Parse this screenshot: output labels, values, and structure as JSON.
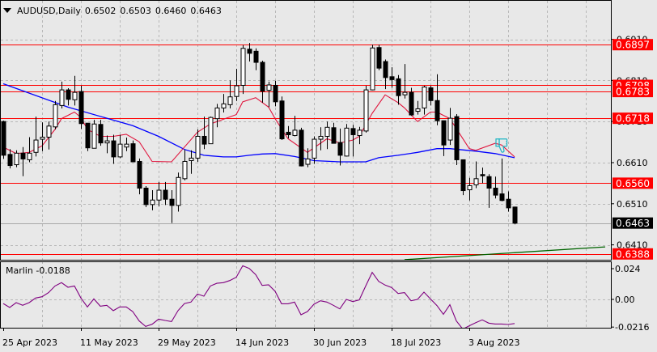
{
  "header": {
    "symbol_timeframe": "AUDUSD,Daily",
    "open": "0.6502",
    "high": "0.6503",
    "low": "0.6460",
    "close": "0.6463",
    "menu_icon": "triangle-down-icon"
  },
  "colors": {
    "background": "#e8e8e8",
    "level_line": "#ff0000",
    "ma_fast": "#e0143c",
    "ma_slow": "#0000ff",
    "trendline": "#006400",
    "indicator": "#800080",
    "signal_icon": "#1fb5c4",
    "bull_body": "#ffffff",
    "bear_body": "#000000"
  },
  "chart_data": [
    {
      "type": "candlestick",
      "y_ticks": [
        "0.6910",
        "0.6810",
        "0.6710",
        "0.6610",
        "0.6510",
        "0.6410"
      ],
      "ylim": [
        0.637,
        0.6935
      ],
      "grid": true,
      "x_tick_labels": [
        {
          "bar": 0,
          "label": "25 Apr 2023"
        },
        {
          "bar": 12,
          "label": "11 May 2023"
        },
        {
          "bar": 24,
          "label": "29 May 2023"
        },
        {
          "bar": 36,
          "label": "14 Jun 2023"
        },
        {
          "bar": 48,
          "label": "30 Jun 2023"
        },
        {
          "bar": 60,
          "label": "18 Jul 2023"
        },
        {
          "bar": 72,
          "label": "3 Aug 2023"
        }
      ],
      "candles_ohlc": [
        [
          0.671,
          0.6712,
          0.6619,
          0.6628
        ],
        [
          0.663,
          0.6643,
          0.6596,
          0.6603
        ],
        [
          0.6605,
          0.664,
          0.6599,
          0.6633
        ],
        [
          0.6633,
          0.6648,
          0.6577,
          0.6619
        ],
        [
          0.6617,
          0.6672,
          0.6611,
          0.6633
        ],
        [
          0.6635,
          0.6722,
          0.6625,
          0.6665
        ],
        [
          0.6667,
          0.6708,
          0.6638,
          0.6672
        ],
        [
          0.6672,
          0.671,
          0.6642,
          0.6699
        ],
        [
          0.6697,
          0.676,
          0.6691,
          0.6751
        ],
        [
          0.6749,
          0.6807,
          0.6742,
          0.6787
        ],
        [
          0.6787,
          0.6791,
          0.6749,
          0.6764
        ],
        [
          0.6763,
          0.6821,
          0.6749,
          0.6781
        ],
        [
          0.6783,
          0.6797,
          0.6692,
          0.6705
        ],
        [
          0.6706,
          0.6706,
          0.6638,
          0.6646
        ],
        [
          0.6645,
          0.6714,
          0.6645,
          0.6704
        ],
        [
          0.6703,
          0.6714,
          0.6651,
          0.6658
        ],
        [
          0.6658,
          0.6676,
          0.6633,
          0.6663
        ],
        [
          0.6663,
          0.6678,
          0.6607,
          0.6624
        ],
        [
          0.6624,
          0.6678,
          0.6621,
          0.6655
        ],
        [
          0.6648,
          0.6671,
          0.6638,
          0.6655
        ],
        [
          0.6656,
          0.6664,
          0.6612,
          0.6612
        ],
        [
          0.6613,
          0.662,
          0.6533,
          0.6548
        ],
        [
          0.6548,
          0.6553,
          0.6502,
          0.6508
        ],
        [
          0.6508,
          0.6543,
          0.6494,
          0.6519
        ],
        [
          0.6519,
          0.6563,
          0.6504,
          0.6543
        ],
        [
          0.6543,
          0.6563,
          0.6507,
          0.6521
        ],
        [
          0.6521,
          0.6543,
          0.6463,
          0.6506
        ],
        [
          0.6506,
          0.6586,
          0.6491,
          0.6574
        ],
        [
          0.6571,
          0.6641,
          0.6567,
          0.6613
        ],
        [
          0.6615,
          0.664,
          0.6583,
          0.6621
        ],
        [
          0.6621,
          0.6691,
          0.6612,
          0.6674
        ],
        [
          0.6674,
          0.6722,
          0.6643,
          0.6655
        ],
        [
          0.6656,
          0.6722,
          0.6656,
          0.672
        ],
        [
          0.6717,
          0.6753,
          0.6696,
          0.6743
        ],
        [
          0.6743,
          0.6777,
          0.6732,
          0.6753
        ],
        [
          0.6751,
          0.681,
          0.6742,
          0.677
        ],
        [
          0.6771,
          0.6838,
          0.676,
          0.6797
        ],
        [
          0.6798,
          0.6896,
          0.6777,
          0.6888
        ],
        [
          0.6886,
          0.6901,
          0.6856,
          0.6876
        ],
        [
          0.6881,
          0.6888,
          0.6835,
          0.6854
        ],
        [
          0.6854,
          0.6858,
          0.6756,
          0.6784
        ],
        [
          0.6786,
          0.6807,
          0.6745,
          0.6799
        ],
        [
          0.6798,
          0.6809,
          0.6747,
          0.6758
        ],
        [
          0.676,
          0.6771,
          0.6665,
          0.6668
        ],
        [
          0.6684,
          0.6699,
          0.6669,
          0.6678
        ],
        [
          0.6676,
          0.6724,
          0.6674,
          0.6689
        ],
        [
          0.6689,
          0.6695,
          0.6601,
          0.6602
        ],
        [
          0.6606,
          0.6645,
          0.6599,
          0.6619
        ],
        [
          0.6621,
          0.6674,
          0.6607,
          0.6667
        ],
        [
          0.6667,
          0.6696,
          0.664,
          0.6674
        ],
        [
          0.6674,
          0.671,
          0.6643,
          0.6696
        ],
        [
          0.6695,
          0.6707,
          0.6657,
          0.6657
        ],
        [
          0.6659,
          0.6693,
          0.6603,
          0.6628
        ],
        [
          0.6626,
          0.6704,
          0.6625,
          0.6694
        ],
        [
          0.6693,
          0.6702,
          0.6625,
          0.6678
        ],
        [
          0.6676,
          0.6697,
          0.6655,
          0.6689
        ],
        [
          0.6687,
          0.6797,
          0.6683,
          0.6787
        ],
        [
          0.6787,
          0.6897,
          0.6786,
          0.6889
        ],
        [
          0.689,
          0.6897,
          0.6835,
          0.684
        ],
        [
          0.6856,
          0.6861,
          0.6789,
          0.6817
        ],
        [
          0.6819,
          0.6842,
          0.6792,
          0.6812
        ],
        [
          0.6814,
          0.6823,
          0.6751,
          0.6773
        ],
        [
          0.6775,
          0.685,
          0.6766,
          0.6781
        ],
        [
          0.6781,
          0.6792,
          0.6724,
          0.6726
        ],
        [
          0.6735,
          0.676,
          0.6727,
          0.6741
        ],
        [
          0.6743,
          0.6797,
          0.6727,
          0.6794
        ],
        [
          0.6792,
          0.6797,
          0.6749,
          0.6761
        ],
        [
          0.6761,
          0.6825,
          0.6701,
          0.6712
        ],
        [
          0.6712,
          0.6712,
          0.6626,
          0.6653
        ],
        [
          0.6665,
          0.6743,
          0.6653,
          0.6718
        ],
        [
          0.6722,
          0.6728,
          0.6604,
          0.6617
        ],
        [
          0.6617,
          0.6617,
          0.6531,
          0.6542
        ],
        [
          0.6544,
          0.6573,
          0.6518,
          0.6554
        ],
        [
          0.6556,
          0.6613,
          0.6548,
          0.6571
        ],
        [
          0.6581,
          0.6598,
          0.656,
          0.6578
        ],
        [
          0.6576,
          0.6582,
          0.65,
          0.6548
        ],
        [
          0.6548,
          0.6576,
          0.6523,
          0.6531
        ],
        [
          0.6534,
          0.662,
          0.6516,
          0.6518
        ],
        [
          0.6521,
          0.654,
          0.6491,
          0.65
        ],
        [
          0.6502,
          0.6503,
          0.646,
          0.6463
        ]
      ],
      "ma_fast": [
        [
          0,
          0.6648
        ],
        [
          2,
          0.6632
        ],
        [
          4,
          0.6635
        ],
        [
          6,
          0.6651
        ],
        [
          8,
          0.6691
        ],
        [
          9,
          0.6717
        ],
        [
          11,
          0.6733
        ],
        [
          12,
          0.672
        ],
        [
          13,
          0.6691
        ],
        [
          15,
          0.6674
        ],
        [
          17,
          0.6674
        ],
        [
          19,
          0.6679
        ],
        [
          21,
          0.6661
        ],
        [
          23,
          0.6613
        ],
        [
          26,
          0.6612
        ],
        [
          28,
          0.6648
        ],
        [
          30,
          0.6684
        ],
        [
          32,
          0.6704
        ],
        [
          36,
          0.6727
        ],
        [
          37,
          0.6758
        ],
        [
          39,
          0.6768
        ],
        [
          41,
          0.6745
        ],
        [
          42,
          0.6717
        ],
        [
          44,
          0.6668
        ],
        [
          47,
          0.6635
        ],
        [
          50,
          0.6668
        ],
        [
          52,
          0.6658
        ],
        [
          54,
          0.6665
        ],
        [
          55,
          0.6674
        ],
        [
          57,
          0.673
        ],
        [
          59,
          0.6775
        ],
        [
          61,
          0.6756
        ],
        [
          62,
          0.6743
        ],
        [
          64,
          0.671
        ],
        [
          66,
          0.6733
        ],
        [
          67,
          0.6733
        ],
        [
          69,
          0.6717
        ],
        [
          72,
          0.6644
        ],
        [
          73,
          0.664
        ],
        [
          76,
          0.6657
        ],
        [
          77,
          0.6653
        ],
        [
          79,
          0.6624
        ]
      ],
      "ma_slow": [
        [
          0,
          0.6802
        ],
        [
          10,
          0.6745
        ],
        [
          20,
          0.67
        ],
        [
          24,
          0.6674
        ],
        [
          28,
          0.6642
        ],
        [
          31,
          0.6628
        ],
        [
          34,
          0.6624
        ],
        [
          36,
          0.6624
        ],
        [
          38,
          0.6628
        ],
        [
          40,
          0.6631
        ],
        [
          42,
          0.6632
        ],
        [
          45,
          0.6625
        ],
        [
          48,
          0.6615
        ],
        [
          52,
          0.6612
        ],
        [
          56,
          0.6612
        ],
        [
          58,
          0.6622
        ],
        [
          61,
          0.6628
        ],
        [
          64,
          0.6635
        ],
        [
          67,
          0.6644
        ],
        [
          69,
          0.6644
        ],
        [
          73,
          0.6638
        ],
        [
          76,
          0.6632
        ],
        [
          79,
          0.6622
        ]
      ],
      "horizontal_levels": [
        "0.6897",
        "0.6798",
        "0.6783",
        "0.6718",
        "0.6560",
        "0.6388"
      ],
      "current_price": "0.6463",
      "trendline": {
        "start": [
          62,
          0.6374
        ],
        "end": [
          93,
          0.6405
        ]
      },
      "signal": {
        "icon": "thumbs-down-icon",
        "bar": 77,
        "price": 0.664
      }
    },
    {
      "type": "line",
      "name": "Marlin",
      "last_value": "-0.0188",
      "y_ticks": [
        "0.024",
        "0.00",
        "-0.0216"
      ],
      "ylim": [
        -0.0216,
        0.024
      ],
      "values": [
        -0.0032,
        -0.0063,
        -0.0025,
        -0.0046,
        -0.0025,
        0.0011,
        0.0021,
        0.0053,
        0.0105,
        0.0131,
        0.0095,
        0.0105,
        0.0011,
        -0.0059,
        0.0004,
        -0.0053,
        -0.0046,
        -0.0088,
        -0.0059,
        -0.0059,
        -0.0095,
        -0.0168,
        -0.0211,
        -0.0194,
        -0.0154,
        -0.0164,
        -0.0173,
        -0.0088,
        -0.0032,
        -0.0021,
        0.0042,
        0.0025,
        0.0105,
        0.0126,
        0.0131,
        0.0147,
        0.0173,
        0.0263,
        0.0242,
        0.0194,
        0.0109,
        0.0114,
        0.0063,
        -0.0034,
        -0.0034,
        -0.0021,
        -0.012,
        -0.0095,
        -0.0038,
        -0.0011,
        -0.0021,
        -0.0046,
        -0.0074,
        0.0,
        -0.0017,
        -0.0004,
        0.0105,
        0.0211,
        0.0141,
        0.0112,
        0.0093,
        0.0046,
        0.0053,
        -0.0011,
        0.0,
        0.0057,
        0.0004,
        -0.0048,
        -0.0116,
        -0.0042,
        -0.0168,
        -0.0232,
        -0.0206,
        -0.0181,
        -0.016,
        -0.0185,
        -0.0192,
        -0.0192,
        -0.0196,
        -0.0188
      ]
    }
  ]
}
